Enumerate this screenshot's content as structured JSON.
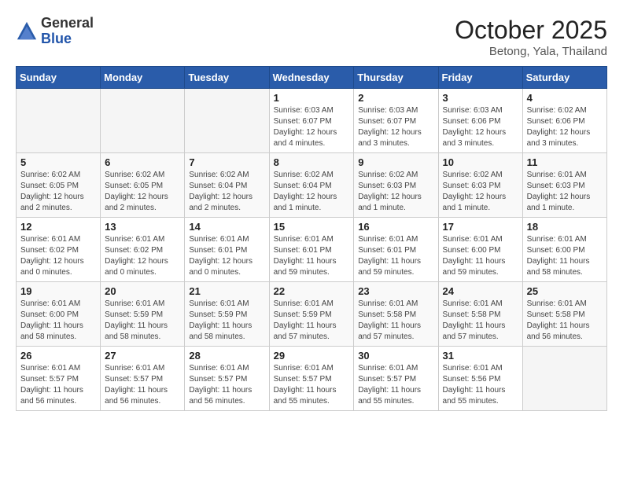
{
  "header": {
    "logo": {
      "general": "General",
      "blue": "Blue"
    },
    "title": "October 2025",
    "subtitle": "Betong, Yala, Thailand"
  },
  "days_of_week": [
    "Sunday",
    "Monday",
    "Tuesday",
    "Wednesday",
    "Thursday",
    "Friday",
    "Saturday"
  ],
  "weeks": [
    [
      {
        "day": "",
        "info": ""
      },
      {
        "day": "",
        "info": ""
      },
      {
        "day": "",
        "info": ""
      },
      {
        "day": "1",
        "info": "Sunrise: 6:03 AM\nSunset: 6:07 PM\nDaylight: 12 hours\nand 4 minutes."
      },
      {
        "day": "2",
        "info": "Sunrise: 6:03 AM\nSunset: 6:07 PM\nDaylight: 12 hours\nand 3 minutes."
      },
      {
        "day": "3",
        "info": "Sunrise: 6:03 AM\nSunset: 6:06 PM\nDaylight: 12 hours\nand 3 minutes."
      },
      {
        "day": "4",
        "info": "Sunrise: 6:02 AM\nSunset: 6:06 PM\nDaylight: 12 hours\nand 3 minutes."
      }
    ],
    [
      {
        "day": "5",
        "info": "Sunrise: 6:02 AM\nSunset: 6:05 PM\nDaylight: 12 hours\nand 2 minutes."
      },
      {
        "day": "6",
        "info": "Sunrise: 6:02 AM\nSunset: 6:05 PM\nDaylight: 12 hours\nand 2 minutes."
      },
      {
        "day": "7",
        "info": "Sunrise: 6:02 AM\nSunset: 6:04 PM\nDaylight: 12 hours\nand 2 minutes."
      },
      {
        "day": "8",
        "info": "Sunrise: 6:02 AM\nSunset: 6:04 PM\nDaylight: 12 hours\nand 1 minute."
      },
      {
        "day": "9",
        "info": "Sunrise: 6:02 AM\nSunset: 6:03 PM\nDaylight: 12 hours\nand 1 minute."
      },
      {
        "day": "10",
        "info": "Sunrise: 6:02 AM\nSunset: 6:03 PM\nDaylight: 12 hours\nand 1 minute."
      },
      {
        "day": "11",
        "info": "Sunrise: 6:01 AM\nSunset: 6:03 PM\nDaylight: 12 hours\nand 1 minute."
      }
    ],
    [
      {
        "day": "12",
        "info": "Sunrise: 6:01 AM\nSunset: 6:02 PM\nDaylight: 12 hours\nand 0 minutes."
      },
      {
        "day": "13",
        "info": "Sunrise: 6:01 AM\nSunset: 6:02 PM\nDaylight: 12 hours\nand 0 minutes."
      },
      {
        "day": "14",
        "info": "Sunrise: 6:01 AM\nSunset: 6:01 PM\nDaylight: 12 hours\nand 0 minutes."
      },
      {
        "day": "15",
        "info": "Sunrise: 6:01 AM\nSunset: 6:01 PM\nDaylight: 11 hours\nand 59 minutes."
      },
      {
        "day": "16",
        "info": "Sunrise: 6:01 AM\nSunset: 6:01 PM\nDaylight: 11 hours\nand 59 minutes."
      },
      {
        "day": "17",
        "info": "Sunrise: 6:01 AM\nSunset: 6:00 PM\nDaylight: 11 hours\nand 59 minutes."
      },
      {
        "day": "18",
        "info": "Sunrise: 6:01 AM\nSunset: 6:00 PM\nDaylight: 11 hours\nand 58 minutes."
      }
    ],
    [
      {
        "day": "19",
        "info": "Sunrise: 6:01 AM\nSunset: 6:00 PM\nDaylight: 11 hours\nand 58 minutes."
      },
      {
        "day": "20",
        "info": "Sunrise: 6:01 AM\nSunset: 5:59 PM\nDaylight: 11 hours\nand 58 minutes."
      },
      {
        "day": "21",
        "info": "Sunrise: 6:01 AM\nSunset: 5:59 PM\nDaylight: 11 hours\nand 58 minutes."
      },
      {
        "day": "22",
        "info": "Sunrise: 6:01 AM\nSunset: 5:59 PM\nDaylight: 11 hours\nand 57 minutes."
      },
      {
        "day": "23",
        "info": "Sunrise: 6:01 AM\nSunset: 5:58 PM\nDaylight: 11 hours\nand 57 minutes."
      },
      {
        "day": "24",
        "info": "Sunrise: 6:01 AM\nSunset: 5:58 PM\nDaylight: 11 hours\nand 57 minutes."
      },
      {
        "day": "25",
        "info": "Sunrise: 6:01 AM\nSunset: 5:58 PM\nDaylight: 11 hours\nand 56 minutes."
      }
    ],
    [
      {
        "day": "26",
        "info": "Sunrise: 6:01 AM\nSunset: 5:57 PM\nDaylight: 11 hours\nand 56 minutes."
      },
      {
        "day": "27",
        "info": "Sunrise: 6:01 AM\nSunset: 5:57 PM\nDaylight: 11 hours\nand 56 minutes."
      },
      {
        "day": "28",
        "info": "Sunrise: 6:01 AM\nSunset: 5:57 PM\nDaylight: 11 hours\nand 56 minutes."
      },
      {
        "day": "29",
        "info": "Sunrise: 6:01 AM\nSunset: 5:57 PM\nDaylight: 11 hours\nand 55 minutes."
      },
      {
        "day": "30",
        "info": "Sunrise: 6:01 AM\nSunset: 5:57 PM\nDaylight: 11 hours\nand 55 minutes."
      },
      {
        "day": "31",
        "info": "Sunrise: 6:01 AM\nSunset: 5:56 PM\nDaylight: 11 hours\nand 55 minutes."
      },
      {
        "day": "",
        "info": ""
      }
    ]
  ]
}
